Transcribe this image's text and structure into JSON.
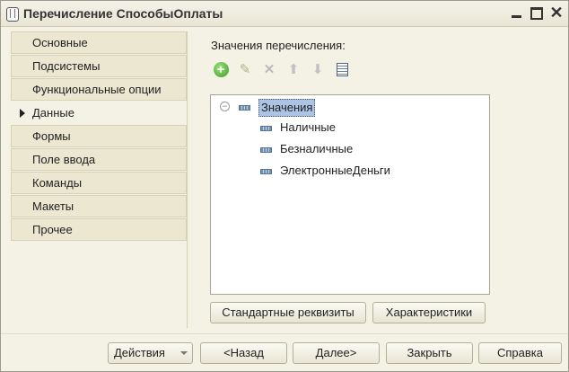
{
  "window": {
    "title": "Перечисление СпособыОплаты"
  },
  "icons": {
    "app": "app-icon",
    "minimize": "minimize-icon",
    "maximize": "maximize-icon",
    "close": "close-icon"
  },
  "nav": {
    "items": [
      {
        "label": "Основные"
      },
      {
        "label": "Подсистемы"
      },
      {
        "label": "Функциональные опции"
      },
      {
        "label": "Данные",
        "active": true
      },
      {
        "label": "Формы"
      },
      {
        "label": "Поле ввода"
      },
      {
        "label": "Команды"
      },
      {
        "label": "Макеты"
      },
      {
        "label": "Прочее"
      }
    ]
  },
  "panel": {
    "label": "Значения перечисления:",
    "toolbar": [
      "add-icon",
      "edit-icon",
      "delete-icon",
      "move-up-icon",
      "move-down-icon",
      "list-icon"
    ],
    "tree": {
      "root": "Значения",
      "children": [
        "Наличные",
        "Безналичные",
        "ЭлектронныеДеньги"
      ]
    },
    "buttons": {
      "standard_attributes": "Стандартные реквизиты",
      "characteristics": "Характеристики"
    }
  },
  "footer": {
    "actions": "Действия",
    "back": "<Назад",
    "next": "Далее>",
    "close": "Закрыть",
    "help": "Справка"
  }
}
